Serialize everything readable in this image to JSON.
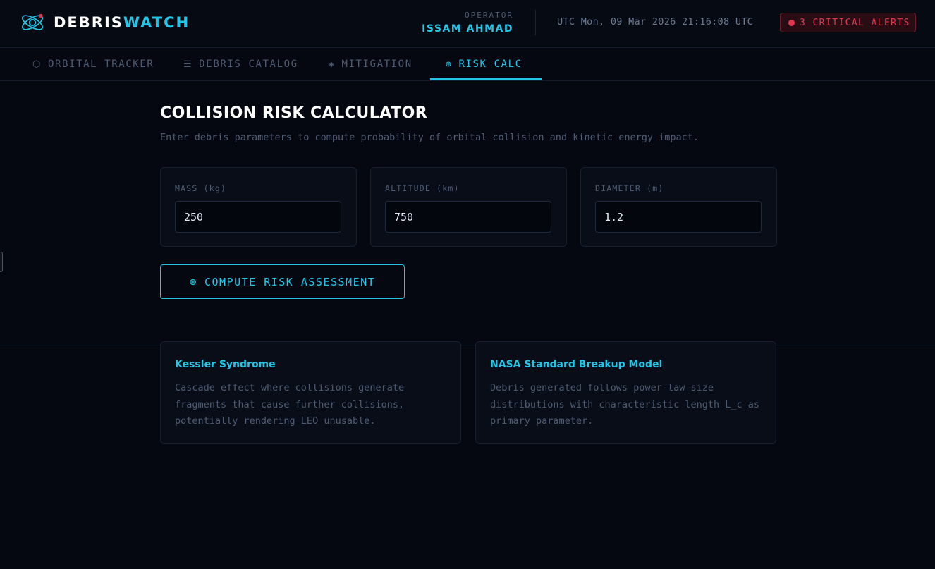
{
  "header": {
    "brand_part1": "DEBRIS",
    "brand_part2": "WATCH",
    "operator_label": "OPERATOR",
    "operator_name": "ISSAM AHMAD",
    "clock": "UTC Mon, 09 Mar 2026 21:16:08 UTC",
    "alert_label": "3 CRITICAL ALERTS",
    "logo_icon": "atom-orbit-icon"
  },
  "tabs": [
    {
      "icon": "⬡",
      "label": "ORBITAL TRACKER",
      "active": false
    },
    {
      "icon": "☰",
      "label": "DEBRIS CATALOG",
      "active": false
    },
    {
      "icon": "◈",
      "label": "MITIGATION",
      "active": false
    },
    {
      "icon": "⊕",
      "label": "RISK CALC",
      "active": true
    }
  ],
  "main": {
    "title": "COLLISION RISK CALCULATOR",
    "subtitle": "Enter debris parameters to compute probability of orbital collision and kinetic energy impact.",
    "params": [
      {
        "label": "MASS (kg)",
        "value": "250"
      },
      {
        "label": "ALTITUDE (km)",
        "value": "750"
      },
      {
        "label": "DIAMETER (m)",
        "value": "1.2"
      }
    ],
    "compute_icon": "⊕",
    "compute_label": "COMPUTE RISK ASSESSMENT",
    "info_cards": [
      {
        "title": "Kessler Syndrome",
        "text": "Cascade effect where collisions generate fragments that cause further collisions, potentially rendering LEO unusable."
      },
      {
        "title": "NASA Standard Breakup Model",
        "text": "Debris generated follows power-law size distributions with characteristic length L_c as primary parameter."
      }
    ]
  },
  "colors": {
    "accent": "#22c7e8",
    "alert": "#e0374f",
    "background": "#050811"
  }
}
